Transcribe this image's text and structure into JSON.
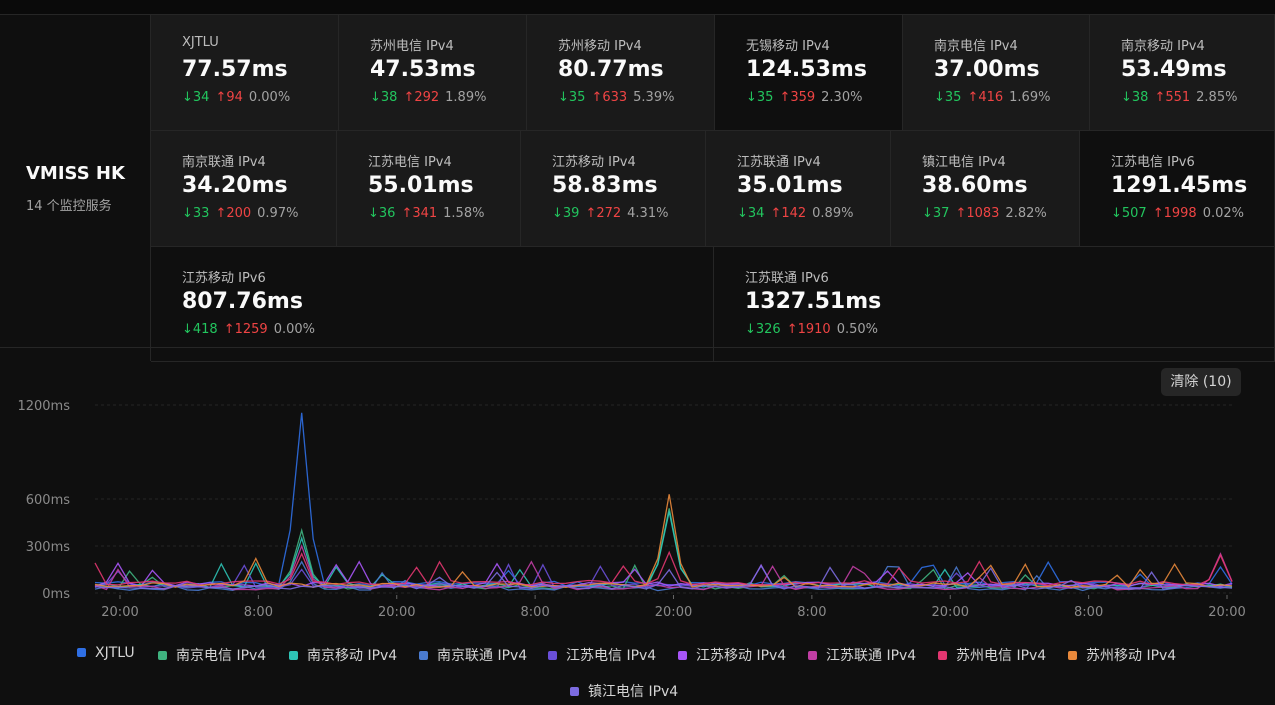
{
  "server": {
    "name": "VMISS HK",
    "subtitle": "14 个监控服务"
  },
  "monitors": [
    {
      "name": "XJTLU",
      "latency": "77.57ms",
      "down": "↓34",
      "up": "↑94",
      "loss": "0.00%"
    },
    {
      "name": "苏州电信 IPv4",
      "latency": "47.53ms",
      "down": "↓38",
      "up": "↑292",
      "loss": "1.89%"
    },
    {
      "name": "苏州移动 IPv4",
      "latency": "80.77ms",
      "down": "↓35",
      "up": "↑633",
      "loss": "5.39%"
    },
    {
      "name": "无锡移动 IPv4",
      "latency": "124.53ms",
      "down": "↓35",
      "up": "↑359",
      "loss": "2.30%"
    },
    {
      "name": "南京电信 IPv4",
      "latency": "37.00ms",
      "down": "↓35",
      "up": "↑416",
      "loss": "1.69%"
    },
    {
      "name": "南京移动 IPv4",
      "latency": "53.49ms",
      "down": "↓38",
      "up": "↑551",
      "loss": "2.85%"
    },
    {
      "name": "南京联通 IPv4",
      "latency": "34.20ms",
      "down": "↓33",
      "up": "↑200",
      "loss": "0.97%"
    },
    {
      "name": "江苏电信 IPv4",
      "latency": "55.01ms",
      "down": "↓36",
      "up": "↑341",
      "loss": "1.58%"
    },
    {
      "name": "江苏移动 IPv4",
      "latency": "58.83ms",
      "down": "↓39",
      "up": "↑272",
      "loss": "4.31%"
    },
    {
      "name": "江苏联通 IPv4",
      "latency": "35.01ms",
      "down": "↓34",
      "up": "↑142",
      "loss": "0.89%"
    },
    {
      "name": "镇江电信 IPv4",
      "latency": "38.60ms",
      "down": "↓37",
      "up": "↑1083",
      "loss": "2.82%"
    },
    {
      "name": "江苏电信 IPv6",
      "latency": "1291.45ms",
      "down": "↓507",
      "up": "↑1998",
      "loss": "0.02%"
    },
    {
      "name": "江苏移动 IPv6",
      "latency": "807.76ms",
      "down": "↓418",
      "up": "↑1259",
      "loss": "0.00%"
    },
    {
      "name": "江苏联通 IPv6",
      "latency": "1327.51ms",
      "down": "↓326",
      "up": "↑1910",
      "loss": "0.50%"
    }
  ],
  "clear_button": "清除 (10)",
  "chart_data": {
    "type": "line",
    "yticks": [
      "1200ms",
      "600ms",
      "300ms",
      "0ms"
    ],
    "ytick_values": [
      1200,
      600,
      300,
      0
    ],
    "ylim": [
      0,
      1200
    ],
    "xticks": [
      "20:00",
      "8:00",
      "20:00",
      "8:00",
      "20:00",
      "8:00",
      "20:00",
      "8:00",
      "20:00"
    ],
    "series": [
      {
        "name": "XJTLU",
        "color": "#2f6fe4",
        "base": 60,
        "spikes": [
          [
            18,
            1150
          ],
          [
            70,
            40
          ]
        ]
      },
      {
        "name": "南京电信 IPv4",
        "color": "#3fb27f",
        "base": 40,
        "spikes": [
          [
            18,
            400
          ],
          [
            50,
            540
          ],
          [
            72,
            80
          ]
        ]
      },
      {
        "name": "南京移动 IPv4",
        "color": "#2ec4b6",
        "base": 50,
        "spikes": [
          [
            18,
            350
          ],
          [
            50,
            520
          ]
        ]
      },
      {
        "name": "南京联通 IPv4",
        "color": "#4a7bd0",
        "base": 30,
        "spikes": [
          [
            18,
            200
          ],
          [
            27,
            80
          ]
        ]
      },
      {
        "name": "江苏电信 IPv4",
        "color": "#6a4fd8",
        "base": 45,
        "spikes": [
          [
            18,
            150
          ],
          [
            80,
            60
          ]
        ]
      },
      {
        "name": "江苏移动 IPv4",
        "color": "#a855f7",
        "base": 55,
        "spikes": [
          [
            21,
            180
          ],
          [
            23,
            200
          ],
          [
            69,
            140
          ]
        ]
      },
      {
        "name": "江苏联通 IPv4",
        "color": "#c13ea4",
        "base": 35,
        "spikes": [
          [
            18,
            300
          ],
          [
            38,
            200
          ],
          [
            98,
            250
          ]
        ]
      },
      {
        "name": "苏州电信 IPv4",
        "color": "#e23670",
        "base": 65,
        "spikes": [
          [
            18,
            250
          ],
          [
            50,
            260
          ],
          [
            98,
            240
          ]
        ]
      },
      {
        "name": "苏州移动 IPv4",
        "color": "#e8883b",
        "base": 50,
        "spikes": [
          [
            14,
            220
          ],
          [
            50,
            630
          ],
          [
            60,
            100
          ],
          [
            77,
            100
          ]
        ]
      },
      {
        "name": "镇江电信 IPv4",
        "color": "#7c6be0",
        "base": 40,
        "spikes": [
          [
            30,
            100
          ],
          [
            85,
            80
          ]
        ]
      }
    ]
  },
  "legend_extra": "镇江电信 IPv4"
}
